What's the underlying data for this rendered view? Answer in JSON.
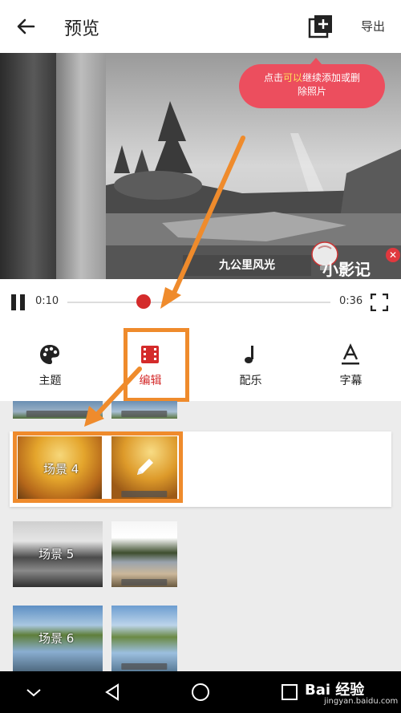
{
  "header": {
    "title": "预览",
    "export_label": "导出",
    "back_icon": "arrow-left-icon",
    "add_icon": "add-photo-icon"
  },
  "preview": {
    "caption": "九公里风光",
    "logo_text": "小影记",
    "close_icon": "close-icon"
  },
  "tooltip": {
    "part1": "点击",
    "part2": "可以",
    "part3": "继续添加或删",
    "part4": "除照片"
  },
  "playback": {
    "current_time": "0:10",
    "total_time": "0:36",
    "progress": 0.29
  },
  "tabs": [
    {
      "label": "主题",
      "icon": "palette-icon"
    },
    {
      "label": "编辑",
      "icon": "film-edit-icon",
      "active": true
    },
    {
      "label": "配乐",
      "icon": "music-note-icon"
    },
    {
      "label": "字幕",
      "icon": "text-underline-icon"
    }
  ],
  "scenes": [
    {
      "label": "场景 4"
    },
    {
      "label": "场景 5"
    },
    {
      "label": "场景 6"
    }
  ],
  "watermark": {
    "brand": "Bai 经验",
    "url": "jingyan.baidu.com"
  },
  "colors": {
    "accent_red": "#d42b2b",
    "tooltip_pink": "#ec4e5e",
    "highlight_orange": "#ef8b2c"
  }
}
